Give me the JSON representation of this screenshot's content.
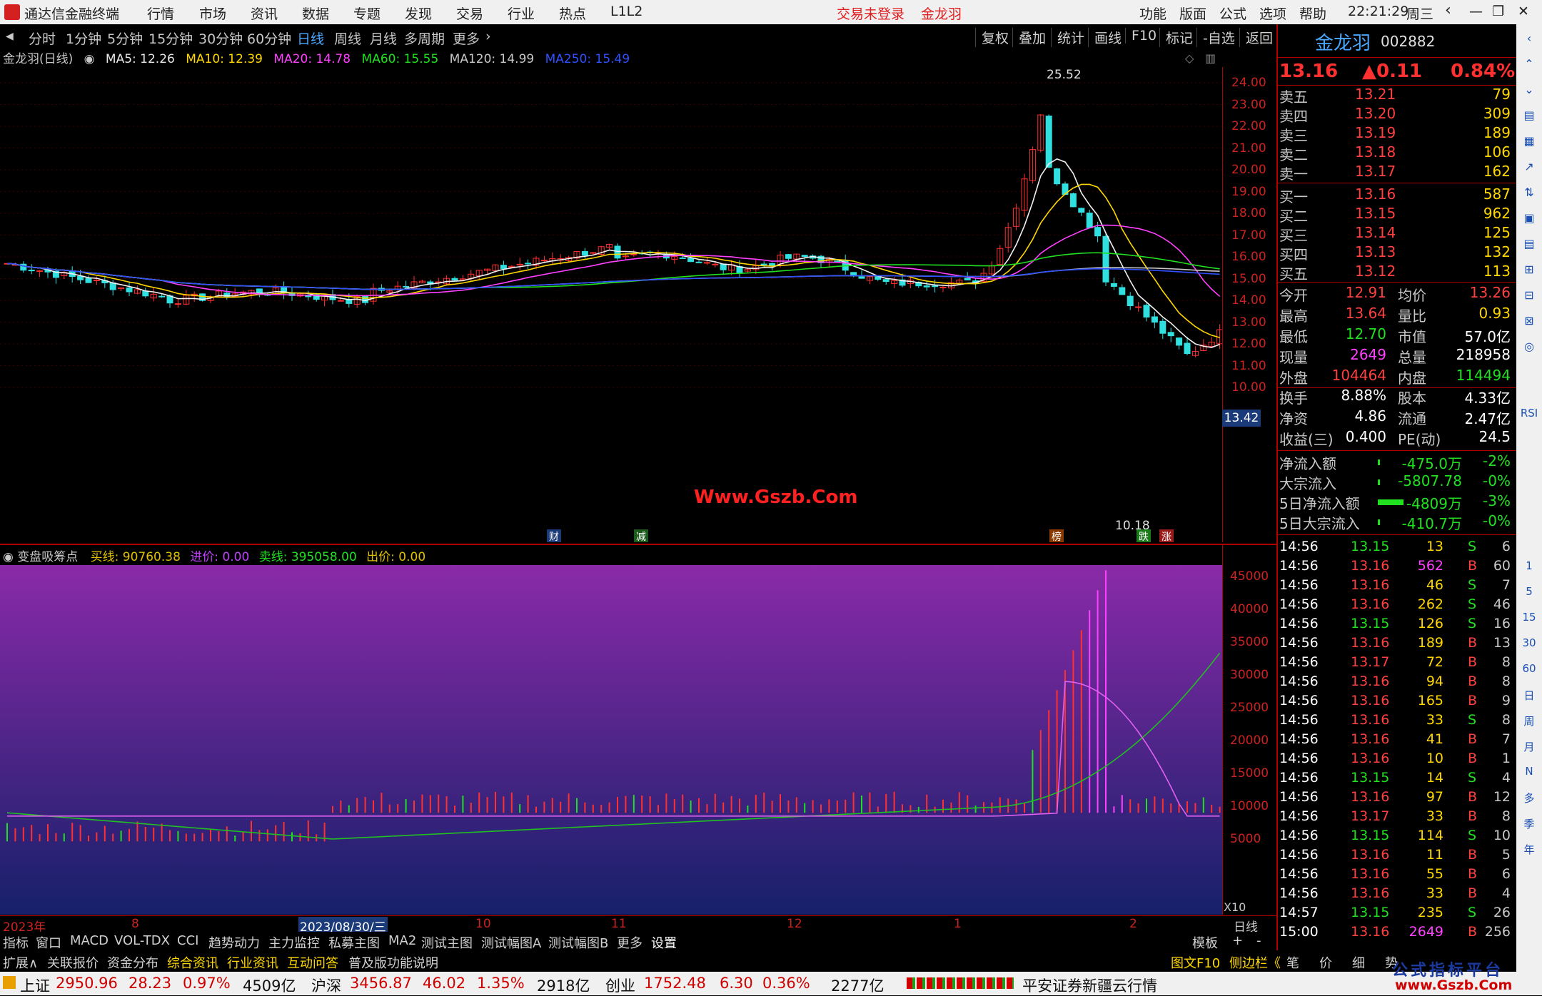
{
  "menubar": {
    "app_title": "通达信金融终端",
    "menus": [
      "行情",
      "市场",
      "资讯",
      "数据",
      "专题",
      "发现",
      "交易",
      "行业",
      "热点",
      "L1L2"
    ],
    "login_status": "交易未登录",
    "stock_name": "金龙羽",
    "right_menus": [
      "功能",
      "版面",
      "公式",
      "选项",
      "帮助"
    ],
    "clock": "22:21:29",
    "weekday": "周三"
  },
  "timeframes": {
    "items": [
      "分时",
      "1分钟",
      "5分钟",
      "15分钟",
      "30分钟",
      "60分钟",
      "日线",
      "周线",
      "月线",
      "多周期",
      "更多"
    ],
    "active": "日线",
    "right_buttons": [
      "复权",
      "叠加",
      "统计",
      "画线",
      "F10",
      "标记",
      "-自选",
      "返回"
    ]
  },
  "ma_bar": {
    "title": "金龙羽(日线)",
    "ma5": "MA5: 12.26",
    "ma10": "MA10: 12.39",
    "ma20": "MA20: 14.78",
    "ma60": "MA60: 15.55",
    "ma120": "MA120: 14.99",
    "ma250": "MA250: 15.49"
  },
  "price_axis": [
    "24.00",
    "23.00",
    "22.00",
    "21.00",
    "20.00",
    "19.00",
    "18.00",
    "17.00",
    "16.00",
    "15.00",
    "14.00",
    "13.00",
    "12.00",
    "11.00",
    "10.00"
  ],
  "price_tag": "13.42",
  "high_label": "25.52",
  "low_label": "10.18",
  "watermark": "Www.Gszb.Com",
  "event_markers": [
    "财",
    "减",
    "榜",
    "跌",
    "涨"
  ],
  "indicator": {
    "name": "变盘吸筹点",
    "buy": "买线: 90760.38",
    "inprice": "进价: 0.00",
    "sell": "卖线: 395058.00",
    "outprice": "出价: 0.00",
    "axis": [
      "45000",
      "40000",
      "35000",
      "30000",
      "25000",
      "20000",
      "15000",
      "10000",
      "5000"
    ],
    "scale": "X10"
  },
  "date_axis": [
    "2023年",
    "8",
    "2023/08/30/三",
    "10",
    "11",
    "12",
    "1",
    "2"
  ],
  "date_axis_label": "日线",
  "bottom_tabs": [
    "指标",
    "窗口",
    "MACD",
    "VOL-TDX",
    "CCI",
    "趋势动力",
    "主力监控",
    "私募主图",
    "MA2",
    "测试主图",
    "测试幅图A",
    "测试幅图B",
    "更多",
    "设置",
    "模板",
    "+",
    "-"
  ],
  "bottom_tabs2": [
    "扩展∧",
    "关联报价",
    "资金分布",
    "综合资讯",
    "行业资讯",
    "互动问答",
    "普及版功能说明"
  ],
  "bottom_right": [
    "图文F10",
    "侧边栏《",
    "笔",
    "价",
    "细",
    "势"
  ],
  "quote": {
    "name": "金龙羽",
    "code": "002882",
    "price": "13.16",
    "change": "▲0.11",
    "pct": "0.84%",
    "asks": [
      {
        "label": "卖五",
        "price": "13.21",
        "vol": "79"
      },
      {
        "label": "卖四",
        "price": "13.20",
        "vol": "309"
      },
      {
        "label": "卖三",
        "price": "13.19",
        "vol": "189"
      },
      {
        "label": "卖二",
        "price": "13.18",
        "vol": "106"
      },
      {
        "label": "卖一",
        "price": "13.17",
        "vol": "162"
      }
    ],
    "bids": [
      {
        "label": "买一",
        "price": "13.16",
        "vol": "587"
      },
      {
        "label": "买二",
        "price": "13.15",
        "vol": "962"
      },
      {
        "label": "买三",
        "price": "13.14",
        "vol": "125"
      },
      {
        "label": "买四",
        "price": "13.13",
        "vol": "132"
      },
      {
        "label": "买五",
        "price": "13.12",
        "vol": "113"
      }
    ],
    "stats": [
      {
        "l1": "今开",
        "v1": "12.91",
        "l2": "均价",
        "v2": "13.26"
      },
      {
        "l1": "最高",
        "v1": "13.64",
        "l2": "量比",
        "v2": "0.93"
      },
      {
        "l1": "最低",
        "v1": "12.70",
        "l2": "市值",
        "v2": "57.0亿"
      },
      {
        "l1": "现量",
        "v1": "2649",
        "l2": "总量",
        "v2": "218958"
      },
      {
        "l1": "外盘",
        "v1": "104464",
        "l2": "内盘",
        "v2": "114494"
      }
    ],
    "stats2": [
      {
        "l1": "换手",
        "v1": "8.88%",
        "l2": "股本",
        "v2": "4.33亿"
      },
      {
        "l1": "净资",
        "v1": "4.86",
        "l2": "流通",
        "v2": "2.47亿"
      },
      {
        "l1": "收益(三)",
        "v1": "0.400",
        "l2": "PE(动)",
        "v2": "24.5"
      }
    ],
    "flows": [
      {
        "label": "净流入额",
        "value": "-475.0万",
        "pct": "-2%"
      },
      {
        "label": "大宗流入",
        "value": "-5807.78",
        "pct": "-0%"
      },
      {
        "label": "5日净流入额",
        "value": "-4809万",
        "pct": "-3%"
      },
      {
        "label": "5日大宗流入",
        "value": "-410.7万",
        "pct": "-0%"
      }
    ]
  },
  "ticks": [
    {
      "t": "14:56",
      "p": "13.15",
      "v": "13",
      "s": "S",
      "n": "6"
    },
    {
      "t": "14:56",
      "p": "13.16",
      "v": "562",
      "s": "B",
      "n": "60"
    },
    {
      "t": "14:56",
      "p": "13.16",
      "v": "46",
      "s": "S",
      "n": "7"
    },
    {
      "t": "14:56",
      "p": "13.16",
      "v": "262",
      "s": "S",
      "n": "46"
    },
    {
      "t": "14:56",
      "p": "13.15",
      "v": "126",
      "s": "S",
      "n": "16"
    },
    {
      "t": "14:56",
      "p": "13.16",
      "v": "189",
      "s": "B",
      "n": "13"
    },
    {
      "t": "14:56",
      "p": "13.17",
      "v": "72",
      "s": "B",
      "n": "8"
    },
    {
      "t": "14:56",
      "p": "13.16",
      "v": "94",
      "s": "B",
      "n": "8"
    },
    {
      "t": "14:56",
      "p": "13.16",
      "v": "165",
      "s": "B",
      "n": "9"
    },
    {
      "t": "14:56",
      "p": "13.16",
      "v": "33",
      "s": "S",
      "n": "8"
    },
    {
      "t": "14:56",
      "p": "13.16",
      "v": "41",
      "s": "B",
      "n": "7"
    },
    {
      "t": "14:56",
      "p": "13.16",
      "v": "10",
      "s": "B",
      "n": "1"
    },
    {
      "t": "14:56",
      "p": "13.15",
      "v": "14",
      "s": "S",
      "n": "4"
    },
    {
      "t": "14:56",
      "p": "13.16",
      "v": "97",
      "s": "B",
      "n": "12"
    },
    {
      "t": "14:56",
      "p": "13.17",
      "v": "33",
      "s": "B",
      "n": "8"
    },
    {
      "t": "14:56",
      "p": "13.15",
      "v": "114",
      "s": "S",
      "n": "10"
    },
    {
      "t": "14:56",
      "p": "13.16",
      "v": "11",
      "s": "B",
      "n": "5"
    },
    {
      "t": "14:56",
      "p": "13.16",
      "v": "55",
      "s": "B",
      "n": "6"
    },
    {
      "t": "14:56",
      "p": "13.16",
      "v": "33",
      "s": "B",
      "n": "4"
    },
    {
      "t": "14:57",
      "p": "13.15",
      "v": "235",
      "s": "S",
      "n": "26"
    },
    {
      "t": "15:00",
      "p": "13.16",
      "v": "2649",
      "s": "B",
      "n": "256"
    }
  ],
  "rail_labels": [
    "RSI",
    "1",
    "5",
    "15",
    "30",
    "60",
    "日",
    "周",
    "月",
    "N",
    "多",
    "季",
    "年"
  ],
  "statusbar": {
    "sh_name": "上证",
    "sh_val": "2950.96",
    "sh_chg": "28.23",
    "sh_pct": "0.97%",
    "sh_amt": "4509亿",
    "hs_name": "沪深",
    "hs_val": "3456.87",
    "hs_chg": "46.02",
    "hs_pct": "1.35%",
    "hs_amt": "2918亿",
    "cy_name": "创业",
    "cy_val": "1752.48",
    "cy_chg": "6.30",
    "cy_pct": "0.36%",
    "cy_amt": "2277亿",
    "broker": "平安证券新疆云行情",
    "logo_text": "公式指标平台",
    "logo_url": "www.Gszb.Com"
  }
}
